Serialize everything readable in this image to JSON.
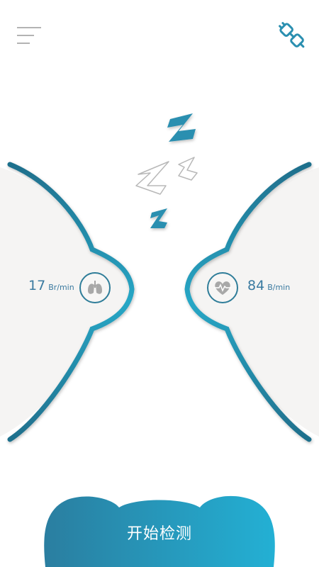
{
  "header": {
    "menu_icon": "hamburger-menu-icon",
    "connect_icon": "plug-connect-icon"
  },
  "status": {
    "sleep_icon": "sleeping-zzz-icon"
  },
  "respiration": {
    "value": "17",
    "unit": "Br/min",
    "icon": "lungs-icon"
  },
  "heart_rate": {
    "value": "84",
    "unit": "B/min",
    "icon": "heartbeat-icon"
  },
  "start_button": {
    "label": "开始检测"
  },
  "colors": {
    "accent": "#2a9ab8",
    "accent_dark": "#1f7492",
    "panel": "#f5f4f3",
    "button_start": "#2a7ea0",
    "button_end": "#23b0d4"
  }
}
